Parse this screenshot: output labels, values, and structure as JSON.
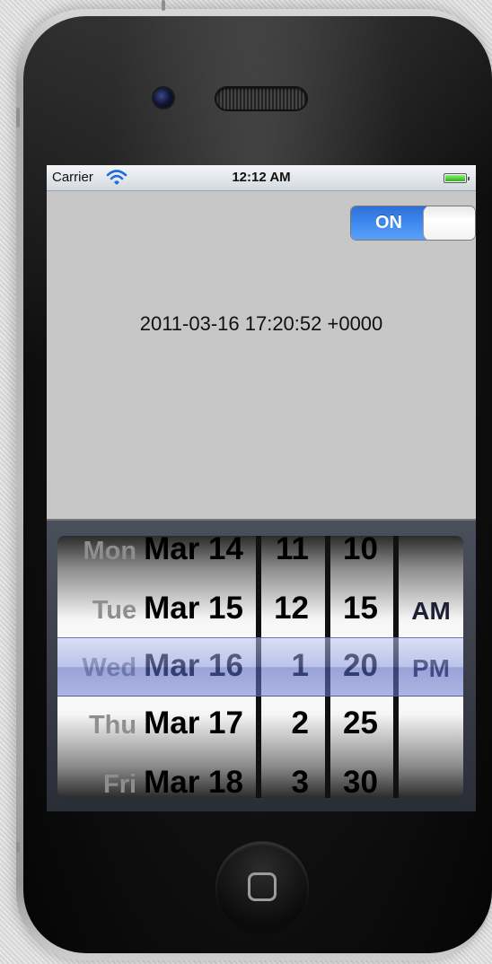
{
  "status_bar": {
    "carrier": "Carrier",
    "time": "12:12 AM",
    "wifi_icon": "wifi-icon",
    "battery_icon": "battery-full-icon",
    "battery_color": "#2fb11a"
  },
  "toggle": {
    "label": "ON",
    "state": "on",
    "accent_color": "#3d8af0"
  },
  "date_label": "2011-03-16 17:20:52 +0000",
  "picker": {
    "days": [
      {
        "name": "Mon",
        "date": "Mar 14"
      },
      {
        "name": "Tue",
        "date": "Mar 15"
      },
      {
        "name": "Wed",
        "date": "Mar 16"
      },
      {
        "name": "Thu",
        "date": "Mar 17"
      },
      {
        "name": "Fri",
        "date": "Mar 18"
      }
    ],
    "hours": [
      "11",
      "12",
      "1",
      "2",
      "3"
    ],
    "minutes": [
      "10",
      "15",
      "20",
      "25",
      "30"
    ],
    "ampm": [
      "AM",
      "PM"
    ],
    "selected": {
      "day": "Wed Mar 16",
      "hour": "1",
      "minute": "20",
      "ampm": "PM"
    },
    "selection_color": "#6e7dcd"
  },
  "hardware": {
    "home_button_icon": "home-button-icon",
    "camera_icon": "camera-icon",
    "speaker_icon": "speaker-grille-icon"
  }
}
